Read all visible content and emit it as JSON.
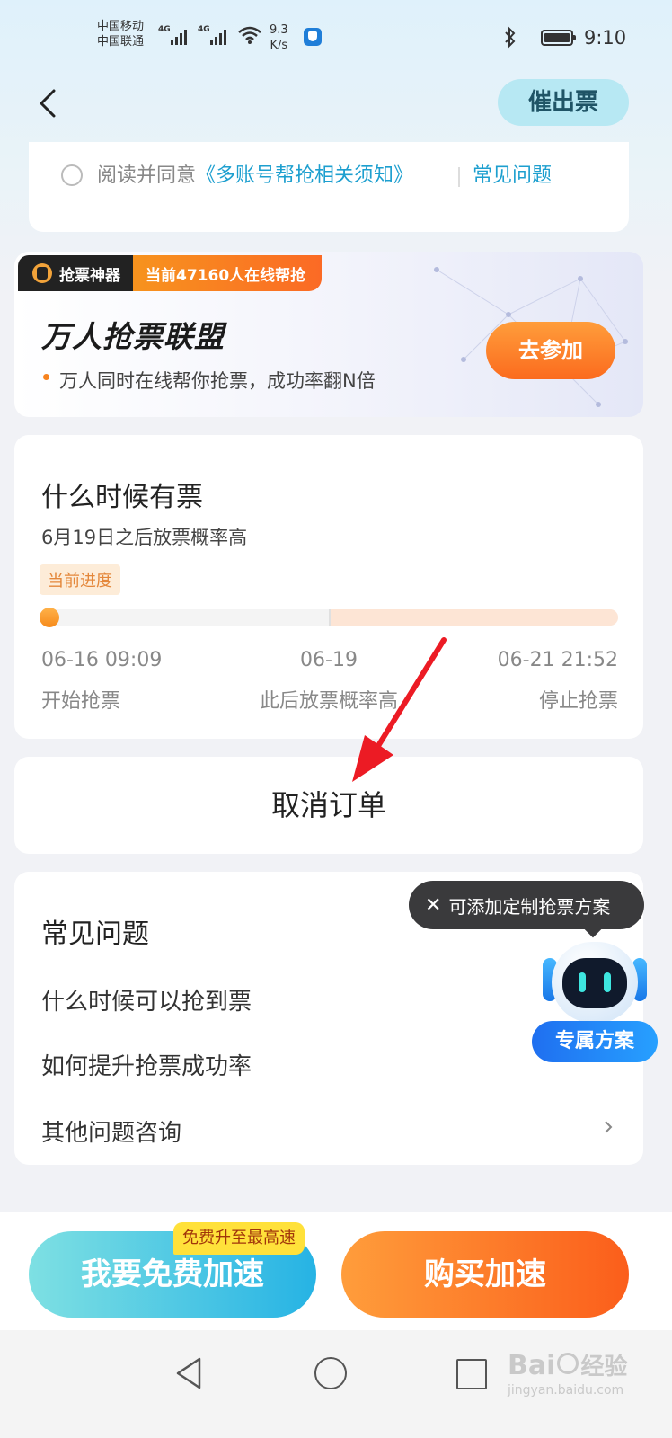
{
  "status_bar": {
    "carrier1": "中国移动",
    "carrier2": "中国联通",
    "net1": "4G",
    "net2": "4G",
    "speed_value": "9.3",
    "speed_unit": "K/s",
    "time": "9:10",
    "bluetooth_icon": "bluetooth-icon",
    "battery_icon": "battery-icon"
  },
  "header": {
    "back_icon": "back-arrow-icon",
    "urge_button": "催出票"
  },
  "agreement": {
    "prefix": "阅读并同意",
    "link": "《多账号帮抢相关须知》",
    "faq_link": "常见问题"
  },
  "banner": {
    "badge": "抢票神器",
    "online": "当前47160人在线帮抢",
    "title": "万人抢票联盟",
    "subtitle": "万人同时在线帮你抢票，成功率翻N倍",
    "join_button": "去参加"
  },
  "timeline": {
    "title": "什么时候有票",
    "subtitle": "6月19日之后放票概率高",
    "progress_tag": "当前进度",
    "start_time": "06-16 09:09",
    "start_label": "开始抢票",
    "mid_time": "06-19",
    "mid_label": "此后放票概率高",
    "end_time": "06-21 21:52",
    "end_label": "停止抢票"
  },
  "cancel_order": "取消订单",
  "faq": {
    "title": "常见问题",
    "items": [
      "什么时候可以抢到票",
      "如何提升抢票成功率",
      "其他问题咨询"
    ]
  },
  "tooltip": {
    "close": "✕",
    "text": "可添加定制抢票方案"
  },
  "assistant": {
    "label": "专属方案"
  },
  "bottom": {
    "free_badge": "免费升至最高速",
    "free_button": "我要免费加速",
    "buy_button": "购买加速"
  },
  "watermark": {
    "brand": "Bai",
    "brand_suffix": "经验",
    "url": "jingyan.baidu.com"
  },
  "colors": {
    "accent_blue": "#1d9fcf",
    "orange": "#fb7a1e",
    "dark_tooltip": "#3a3a3c"
  }
}
